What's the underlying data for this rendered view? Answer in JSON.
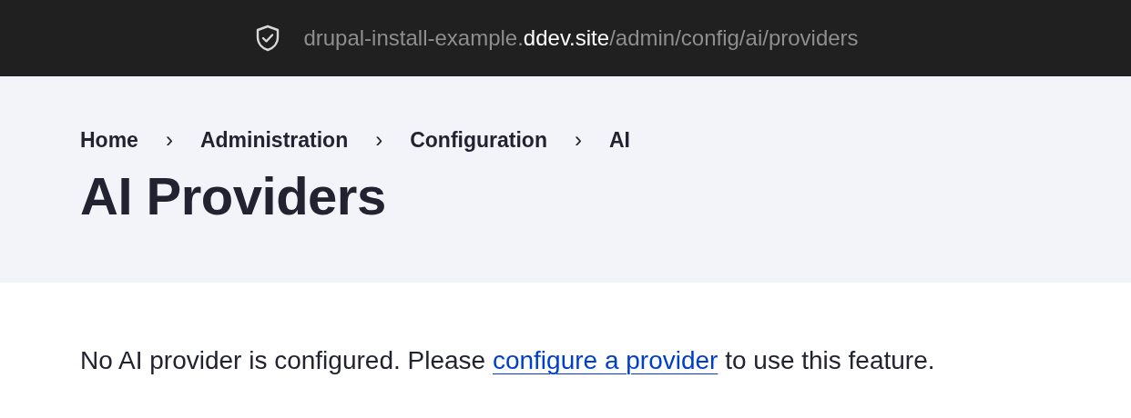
{
  "address_bar": {
    "url_prefix": "drupal-install-example.",
    "url_domain": "ddev.site",
    "url_path": "/admin/config/ai/providers"
  },
  "breadcrumb": [
    {
      "label": "Home",
      "separator": "›"
    },
    {
      "label": "Administration",
      "separator": "›"
    },
    {
      "label": "Configuration",
      "separator": "›"
    },
    {
      "label": "AI"
    }
  ],
  "page_title": "AI Providers",
  "message": {
    "before": "No AI provider is configured. Please ",
    "link": "configure a provider",
    "after": " to use this feature."
  }
}
